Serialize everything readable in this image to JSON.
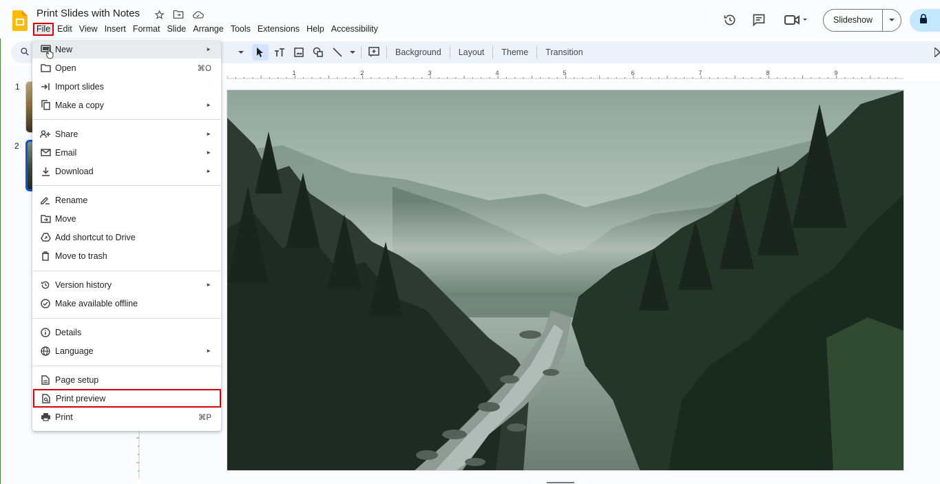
{
  "app": {
    "doc_title": "Print Slides with Notes",
    "menu": [
      "File",
      "Edit",
      "View",
      "Insert",
      "Format",
      "Slide",
      "Arrange",
      "Tools",
      "Extensions",
      "Help",
      "Accessibility"
    ],
    "slideshow_label": "Slideshow"
  },
  "toolbar": {
    "background": "Background",
    "layout": "Layout",
    "theme": "Theme",
    "transition": "Transition"
  },
  "slides": {
    "num1": "1",
    "num2": "2"
  },
  "ruler": {
    "marks": [
      "1",
      "2",
      "3",
      "4",
      "5",
      "6",
      "7",
      "8",
      "9"
    ]
  },
  "file_menu": {
    "items": [
      {
        "label": "New",
        "icon": "new-slides-icon",
        "arrow": "►",
        "key": ""
      },
      {
        "label": "Open",
        "icon": "folder-open-icon",
        "arrow": "",
        "key": "⌘O"
      },
      {
        "label": "Import slides",
        "icon": "import-icon",
        "arrow": "",
        "key": ""
      },
      {
        "label": "Make a copy",
        "icon": "copy-icon",
        "arrow": "►",
        "key": ""
      },
      {
        "label": "Share",
        "icon": "person-add-icon",
        "arrow": "►",
        "key": ""
      },
      {
        "label": "Email",
        "icon": "email-icon",
        "arrow": "►",
        "key": ""
      },
      {
        "label": "Download",
        "icon": "download-icon",
        "arrow": "►",
        "key": ""
      },
      {
        "label": "Rename",
        "icon": "rename-icon",
        "arrow": "",
        "key": ""
      },
      {
        "label": "Move",
        "icon": "move-folder-icon",
        "arrow": "",
        "key": ""
      },
      {
        "label": "Add shortcut to Drive",
        "icon": "drive-shortcut-icon",
        "arrow": "",
        "key": ""
      },
      {
        "label": "Move to trash",
        "icon": "trash-icon",
        "arrow": "",
        "key": ""
      },
      {
        "label": "Version history",
        "icon": "history-icon",
        "arrow": "►",
        "key": ""
      },
      {
        "label": "Make available offline",
        "icon": "offline-icon",
        "arrow": "",
        "key": ""
      },
      {
        "label": "Details",
        "icon": "info-icon",
        "arrow": "",
        "key": ""
      },
      {
        "label": "Language",
        "icon": "globe-icon",
        "arrow": "►",
        "key": ""
      },
      {
        "label": "Page setup",
        "icon": "page-icon",
        "arrow": "",
        "key": ""
      },
      {
        "label": "Print preview",
        "icon": "print-preview-icon",
        "arrow": "",
        "key": ""
      },
      {
        "label": "Print",
        "icon": "print-icon",
        "arrow": "",
        "key": "⌘P"
      }
    ]
  },
  "colors": {
    "highlight_box": "#d10000",
    "share_button": "#c2e7ff",
    "toolbar_bg": "#edf2fa",
    "selected_slide_border": "#0b57d0"
  }
}
